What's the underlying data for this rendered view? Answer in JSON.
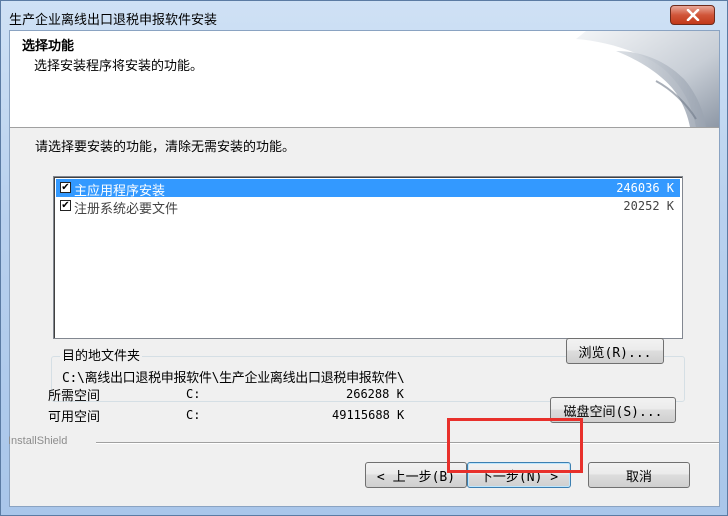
{
  "window": {
    "title": "生产企业离线出口退税申报软件安装",
    "close_icon": "close-icon"
  },
  "header": {
    "title": "选择功能",
    "subtitle": "选择安装程序将安装的功能。"
  },
  "instruction": "请选择要安装的功能，清除无需安装的功能。",
  "features": [
    {
      "label": "主应用程序安装",
      "size": "246036 K",
      "checked": true,
      "selected": true
    },
    {
      "label": "注册系统必要文件",
      "size": "20252 K",
      "checked": true,
      "selected": false
    }
  ],
  "destination": {
    "group_label": "目的地文件夹",
    "path": "C:\\离线出口退税申报软件\\生产企业离线出口退税申报软件\\",
    "browse_button": "浏览(R)..."
  },
  "space": {
    "required_label": "所需空间",
    "required_drive": "C:",
    "required_value": "266288 K",
    "available_label": "可用空间",
    "available_drive": "C:",
    "available_value": "49115688 K",
    "disk_space_button": "磁盘空间(S)..."
  },
  "footer": {
    "brand": "InstallShield",
    "back_button": "< 上一步(B)",
    "next_button": "下一步(N) >",
    "cancel_button": "取消"
  },
  "colors": {
    "selection": "#3399ff",
    "highlight_box": "#e8302b"
  }
}
